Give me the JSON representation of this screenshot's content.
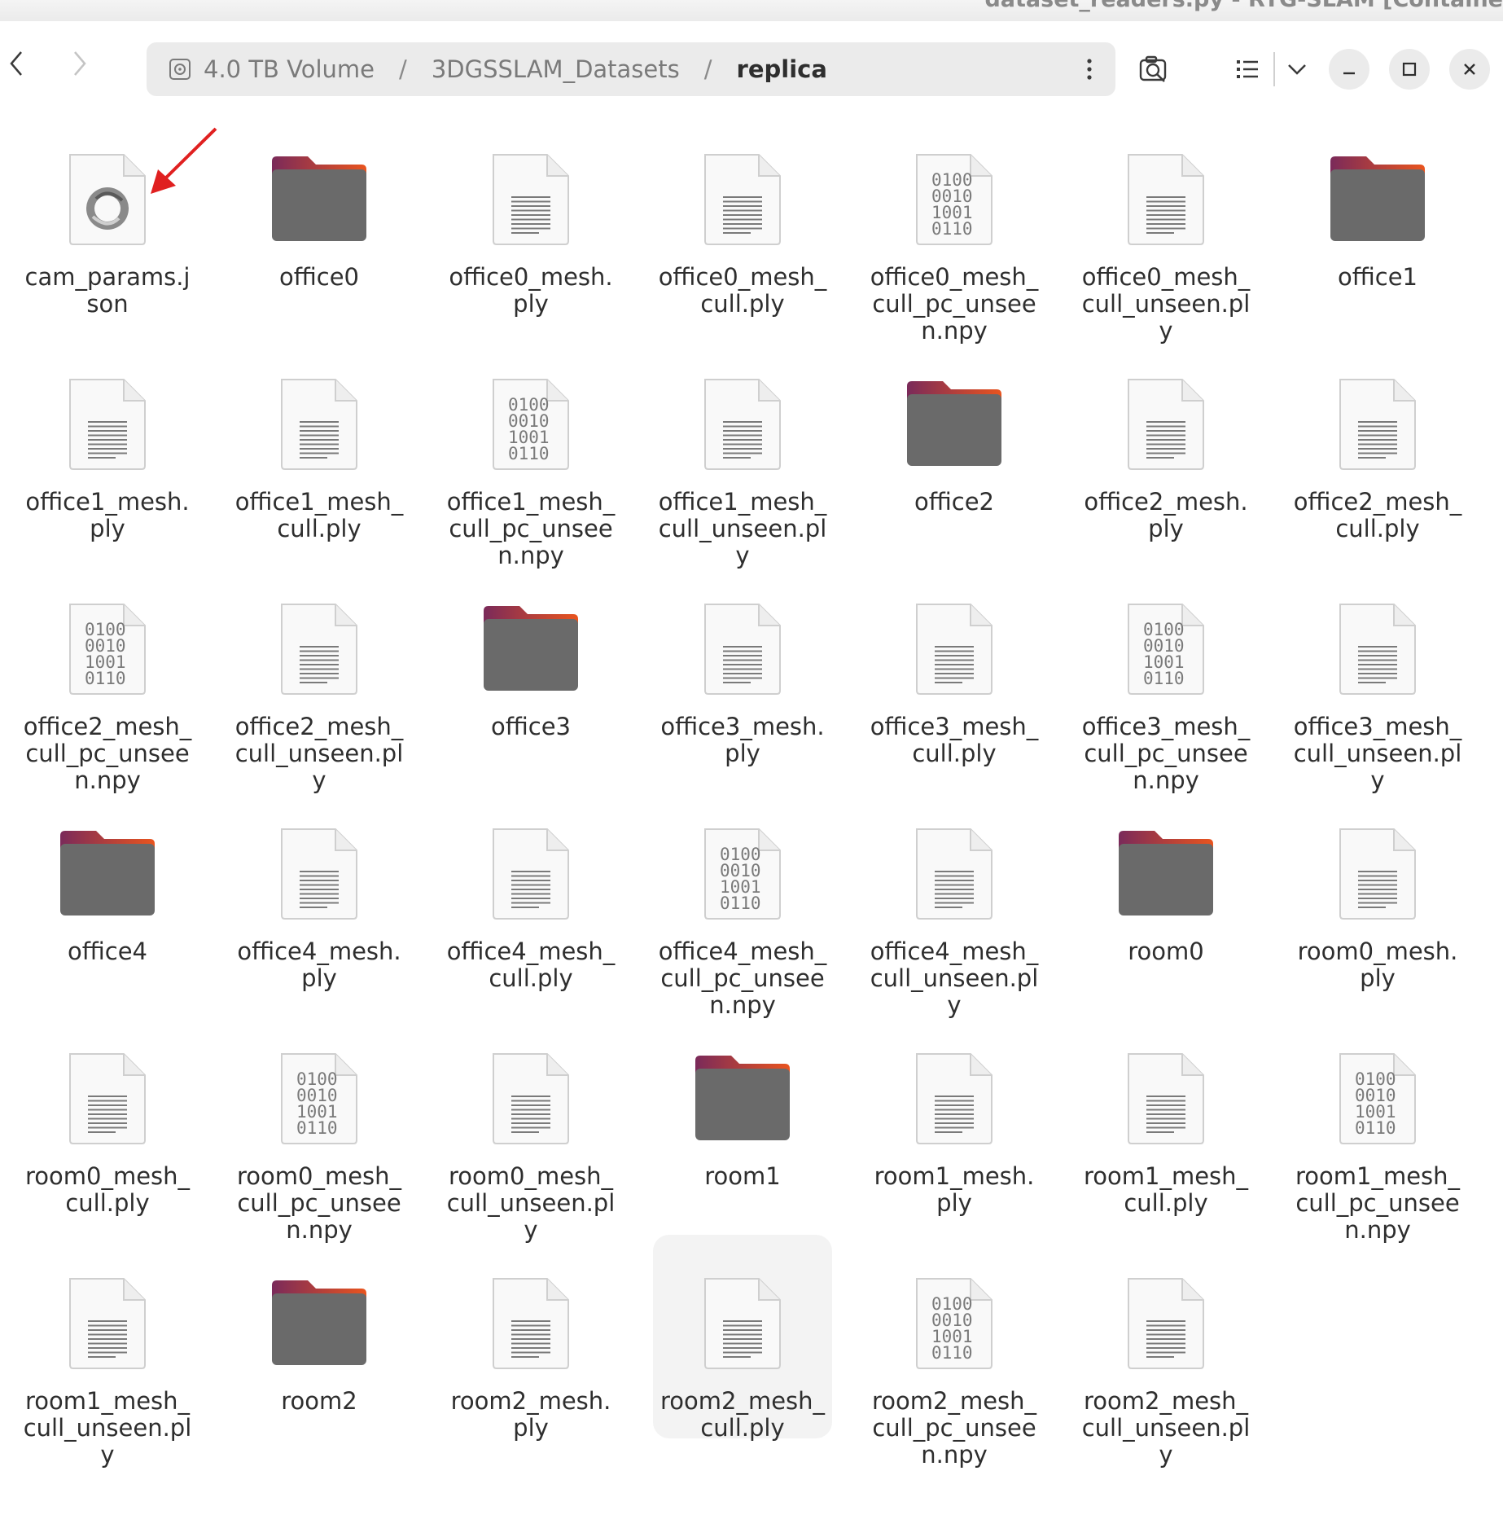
{
  "window": {
    "title": "dataset_readers.py - RTG-SLAM [Containe"
  },
  "breadcrumb": {
    "segments": [
      "4.0 TB Volume",
      "3DGSSLAM_Datasets",
      "replica"
    ],
    "separator": "/"
  },
  "icons": {
    "back": "chevron-left-icon",
    "forward": "chevron-right-icon",
    "drive": "hard-drive-icon",
    "menu": "vertical-ellipsis-icon",
    "search": "search-icon",
    "view": "list-view-icon",
    "view_dropdown": "chevron-down-icon",
    "minimize": "minimize-icon",
    "maximize": "maximize-icon",
    "close": "close-icon"
  },
  "colors": {
    "folder_top_left": "#7a2a5a",
    "folder_top_right": "#e9541e",
    "folder_body": "#6a6a6a",
    "selection": "#f3f3f3",
    "annotation_arrow": "#e02020"
  },
  "files": [
    {
      "name": "cam_params.json",
      "type": "json"
    },
    {
      "name": "office0",
      "type": "folder"
    },
    {
      "name": "office0_mesh.ply",
      "type": "text"
    },
    {
      "name": "office0_mesh_cull.ply",
      "type": "text"
    },
    {
      "name": "office0_mesh_cull_pc_unseen.npy",
      "type": "binary"
    },
    {
      "name": "office0_mesh_cull_unseen.ply",
      "type": "text"
    },
    {
      "name": "office1",
      "type": "folder"
    },
    {
      "name": "office1_mesh.ply",
      "type": "text"
    },
    {
      "name": "office1_mesh_cull.ply",
      "type": "text"
    },
    {
      "name": "office1_mesh_cull_pc_unseen.npy",
      "type": "binary"
    },
    {
      "name": "office1_mesh_cull_unseen.ply",
      "type": "text"
    },
    {
      "name": "office2",
      "type": "folder"
    },
    {
      "name": "office2_mesh.ply",
      "type": "text"
    },
    {
      "name": "office2_mesh_cull.ply",
      "type": "text"
    },
    {
      "name": "office2_mesh_cull_pc_unseen.npy",
      "type": "binary"
    },
    {
      "name": "office2_mesh_cull_unseen.ply",
      "type": "text"
    },
    {
      "name": "office3",
      "type": "folder"
    },
    {
      "name": "office3_mesh.ply",
      "type": "text"
    },
    {
      "name": "office3_mesh_cull.ply",
      "type": "text"
    },
    {
      "name": "office3_mesh_cull_pc_unseen.npy",
      "type": "binary"
    },
    {
      "name": "office3_mesh_cull_unseen.ply",
      "type": "text"
    },
    {
      "name": "office4",
      "type": "folder"
    },
    {
      "name": "office4_mesh.ply",
      "type": "text"
    },
    {
      "name": "office4_mesh_cull.ply",
      "type": "text"
    },
    {
      "name": "office4_mesh_cull_pc_unseen.npy",
      "type": "binary"
    },
    {
      "name": "office4_mesh_cull_unseen.ply",
      "type": "text"
    },
    {
      "name": "room0",
      "type": "folder"
    },
    {
      "name": "room0_mesh.ply",
      "type": "text"
    },
    {
      "name": "room0_mesh_cull.ply",
      "type": "text"
    },
    {
      "name": "room0_mesh_cull_pc_unseen.npy",
      "type": "binary"
    },
    {
      "name": "room0_mesh_cull_unseen.ply",
      "type": "text"
    },
    {
      "name": "room1",
      "type": "folder"
    },
    {
      "name": "room1_mesh.ply",
      "type": "text"
    },
    {
      "name": "room1_mesh_cull.ply",
      "type": "text"
    },
    {
      "name": "room1_mesh_cull_pc_unseen.npy",
      "type": "binary"
    },
    {
      "name": "room1_mesh_cull_unseen.ply",
      "type": "text"
    },
    {
      "name": "room2",
      "type": "folder"
    },
    {
      "name": "room2_mesh.ply",
      "type": "text"
    },
    {
      "name": "room2_mesh_cull.ply",
      "type": "text",
      "selected": true
    },
    {
      "name": "room2_mesh_cull_pc_unseen.npy",
      "type": "binary"
    },
    {
      "name": "room2_mesh_cull_unseen.ply",
      "type": "text"
    }
  ]
}
